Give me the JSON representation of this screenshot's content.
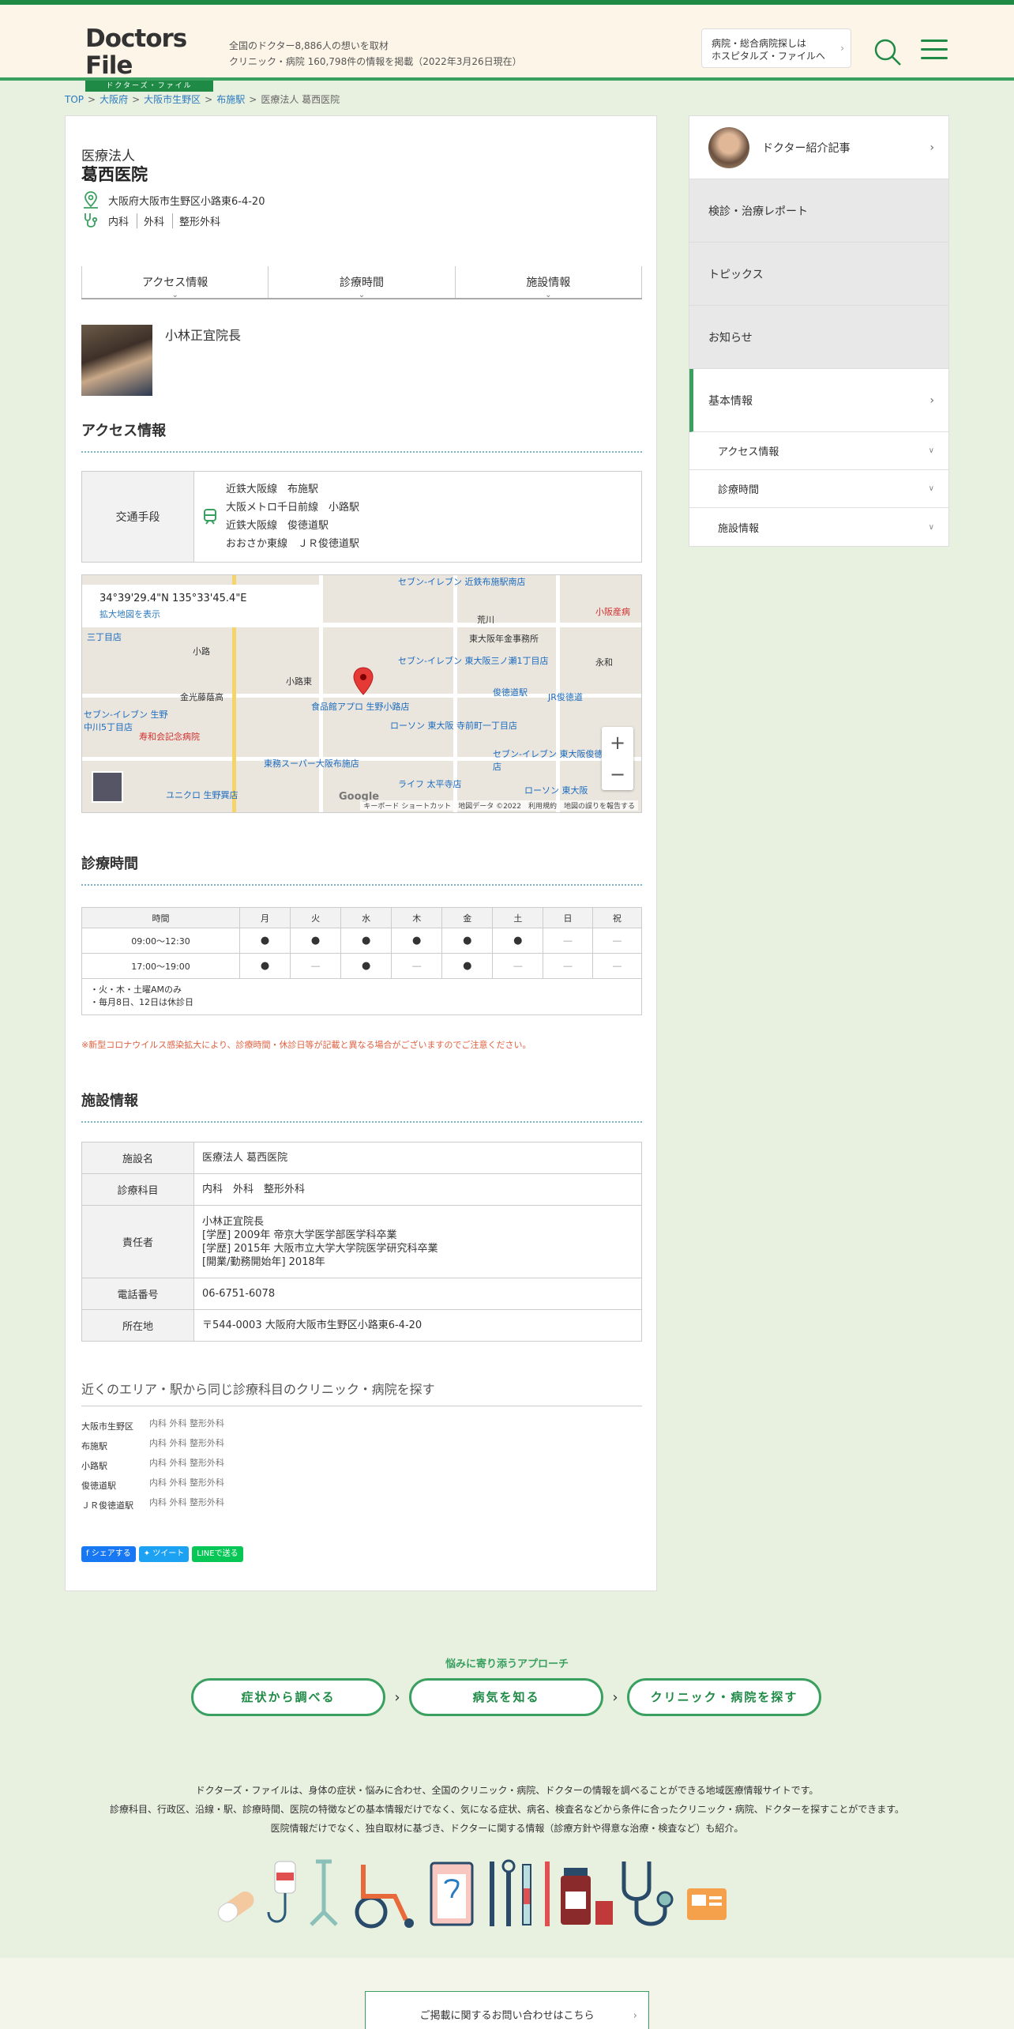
{
  "header": {
    "logo_main": "Doctors File",
    "logo_sub": "ドクターズ・ファイル",
    "desc_line1": "全国のドクター8,886人の想いを取材",
    "desc_line2": "クリニック・病院 160,798件の情報を掲載（2022年3月26日現在）",
    "hosp_btn_line1": "病院・総合病院探しは",
    "hosp_btn_line2": "ホスピタルズ・ファイルへ"
  },
  "breadcrumb": [
    "TOP",
    "大阪府",
    "大阪市生野区",
    "布施駅",
    "医療法人 葛西医院"
  ],
  "clinic": {
    "corp": "医療法人",
    "name": "葛西医院",
    "address": "大阪府大阪市生野区小路東6-4-20",
    "departments": [
      "内科",
      "外科",
      "整形外科"
    ]
  },
  "tabs": [
    "アクセス情報",
    "診療時間",
    "施設情報"
  ],
  "doctor": {
    "name": "小林正宜院長"
  },
  "access": {
    "title": "アクセス情報",
    "label": "交通手段",
    "lines": [
      "近鉄大阪線　布施駅",
      "大阪メトロ千日前線　小路駅",
      "近鉄大阪線　俊徳道駅",
      "おおさか東線　ＪＲ俊徳道駅"
    ]
  },
  "map": {
    "coord": "34°39'29.4\"N 135°33'45.4\"E",
    "enlarge": "拡大地図を表示",
    "footer": "キーボード ショートカット　地図データ ©2022　利用規約　地図の誤りを報告する",
    "labels": [
      "セブン-イレブン 近鉄布施駅南店",
      "荒川",
      "小阪産病",
      "東大阪年金事務所",
      "永和",
      "セブン-イレブン 東大阪三ノ瀬1丁目店",
      "俊徳道駅",
      "JR俊徳道",
      "小路東",
      "小路",
      "金光藤蔭高",
      "食品館アプロ 生野小路店",
      "ローソン 東大阪 寺前町一丁目店",
      "寿和会記念病院",
      "東務スーパー大阪布施店",
      "セブン-イレブン 東大阪俊徳町3丁目店",
      "ライフ 太平寺店",
      "ローソン 東大阪",
      "ユニクロ 生野巽店",
      "三丁目店",
      "セブン-イレブン 生野中川5丁目店",
      "Google"
    ]
  },
  "hours": {
    "title": "診療時間",
    "headers": [
      "時間",
      "月",
      "火",
      "水",
      "木",
      "金",
      "土",
      "日",
      "祝"
    ],
    "rows": [
      [
        "09:00〜12:30",
        "●",
        "●",
        "●",
        "●",
        "●",
        "●",
        "―",
        "―"
      ],
      [
        "17:00〜19:00",
        "●",
        "―",
        "●",
        "―",
        "●",
        "―",
        "―",
        "―"
      ]
    ],
    "note_line1": "・火・木・土曜AMのみ",
    "note_line2": "・毎月8日、12日は休診日",
    "covid": "※新型コロナウイルス感染拡大により、診療時間・休診日等が記載と異なる場合がございますのでご注意ください。"
  },
  "facility": {
    "title": "施設情報",
    "rows": [
      {
        "label": "施設名",
        "lines": [
          "医療法人 葛西医院"
        ]
      },
      {
        "label": "診療科目",
        "lines": [
          "内科　外科　整形外科"
        ]
      },
      {
        "label": "責任者",
        "lines": [
          "小林正宜院長",
          "[学歴] 2009年 帝京大学医学部医学科卒業",
          "[学歴] 2015年 大阪市立大学大学院医学研究科卒業",
          "[開業/勤務開始年] 2018年"
        ]
      },
      {
        "label": "電話番号",
        "lines": [
          "06-6751-6078"
        ]
      },
      {
        "label": "所在地",
        "lines": [
          "〒544-0003 大阪府大阪市生野区小路東6-4-20"
        ]
      }
    ]
  },
  "nearby": {
    "title": "近くのエリア・駅から同じ診療科目のクリニック・病院を探す",
    "rows": [
      {
        "station": "大阪市生野区",
        "depts": "内科 外科 整形外科"
      },
      {
        "station": "布施駅",
        "depts": "内科 外科 整形外科"
      },
      {
        "station": "小路駅",
        "depts": "内科 外科 整形外科"
      },
      {
        "station": "俊徳道駅",
        "depts": "内科 外科 整形外科"
      },
      {
        "station": "ＪＲ俊徳道駅",
        "depts": "内科 外科 整形外科"
      }
    ]
  },
  "share": {
    "fb": "シェアする",
    "tw": "ツイート",
    "line": "LINEで送る"
  },
  "sidebar": {
    "items": [
      "ドクター紹介記事",
      "検診・治療レポート",
      "トピックス",
      "お知らせ",
      "基本情報"
    ],
    "subs": [
      "アクセス情報",
      "診療時間",
      "施設情報"
    ]
  },
  "approach": {
    "label": "悩みに寄り添うアプローチ",
    "buttons": [
      "症状から調べる",
      "病気を知る",
      "クリニック・病院を探す"
    ]
  },
  "about": {
    "line1": "ドクターズ・ファイルは、身体の症状・悩みに合わせ、全国のクリニック・病院、ドクターの情報を調べることができる地域医療情報サイトです。",
    "line2": "診療科目、行政区、沿線・駅、診療時間、医院の特徴などの基本情報だけでなく、気になる症状、病名、検査名などから条件に合ったクリニック・病院、ドクターを探すことができます。",
    "line3": "医院情報だけでなく、独自取材に基づき、ドクターに関する情報（診療方針や得意な治療・検査など）も紹介。"
  },
  "footer": {
    "contact": "ご掲載に関するお問い合わせはこちら"
  },
  "colors": {
    "brand": "#1e8a45",
    "accent": "#3aa060",
    "notice": "#e06040"
  }
}
